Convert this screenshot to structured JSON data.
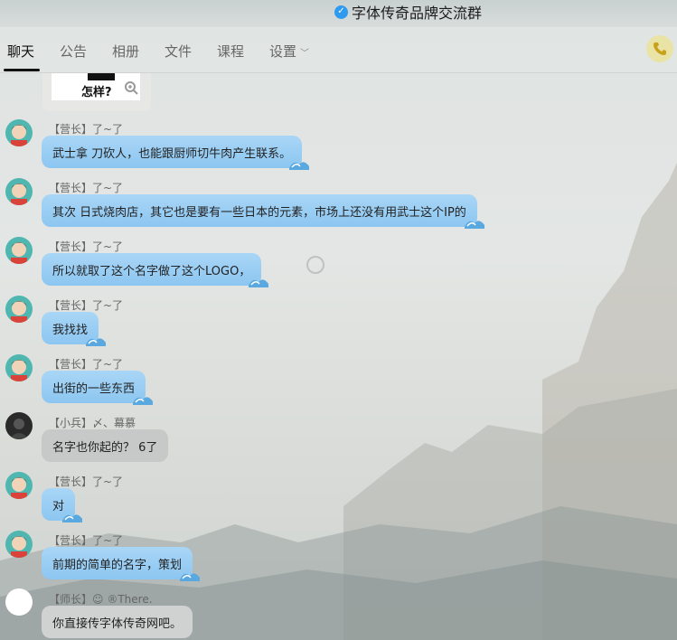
{
  "header": {
    "title": "字体传奇品牌交流群"
  },
  "tabs": [
    {
      "label": "聊天"
    },
    {
      "label": "公告"
    },
    {
      "label": "相册"
    },
    {
      "label": "文件"
    },
    {
      "label": "课程"
    },
    {
      "label": "设置"
    }
  ],
  "image_message": {
    "caption": "怎样?"
  },
  "messages": [
    {
      "sender": "【营长】了~了",
      "text": "武士拿 刀砍人，也能跟厨师切牛肉产生联系。"
    },
    {
      "sender": "【营长】了~了",
      "text": "其次 日式烧肉店，其它也是要有一些日本的元素，市场上还没有用武士这个IP的"
    },
    {
      "sender": "【营长】了~了",
      "text": "所以就取了这个名字做了这个LOGO，"
    },
    {
      "sender": "【营长】了~了",
      "text": "我找找"
    },
    {
      "sender": "【营长】了~了",
      "text": "出街的一些东西"
    },
    {
      "sender": "【小兵】〆、幕慕",
      "text": "名字也你起的？  6了"
    },
    {
      "sender": "【营长】了~了",
      "text": "对"
    },
    {
      "sender": "【营长】了~了",
      "text": "前期的简单的名字，策划"
    },
    {
      "sender": "【师长】☺ ®There.",
      "text": "你直接传字体传奇网吧。"
    }
  ],
  "colors": {
    "bubble_blue": "#9fd0f4",
    "bubble_gray": "#c6c9c7",
    "accent": "#2e9bf0"
  }
}
